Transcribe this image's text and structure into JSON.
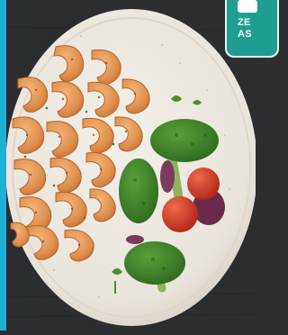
{
  "photo": {
    "subject": "",
    "colors": {
      "background": "#2b2d31",
      "edge_strip": "#1fb0d6",
      "plate": "#eeeae3",
      "plate_rim": "#d9d3c8",
      "shrimp": "#e39a58",
      "broccoli": "#3f7f2a",
      "tomato": "#c83a24",
      "onion": "#6b2a4a"
    }
  },
  "badge": {
    "line1": "ZE",
    "line2": "AS",
    "color": "#1f9e8f"
  }
}
